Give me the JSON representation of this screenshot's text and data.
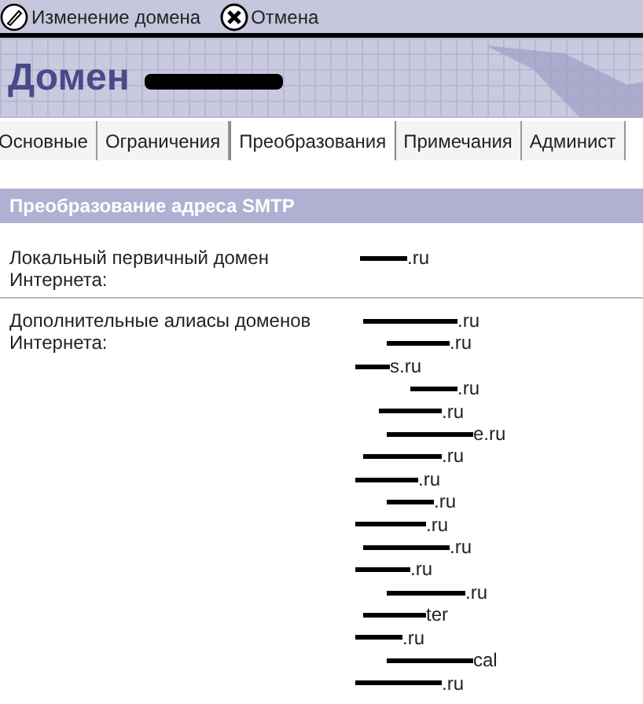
{
  "toolbar": [
    {
      "kind": "edit",
      "label": "Изменение домена"
    },
    {
      "kind": "cancel",
      "label": "Отмена"
    }
  ],
  "banner": {
    "title": "Домен",
    "name_redacted": true
  },
  "tabs": [
    {
      "label": "Основные",
      "selected": false
    },
    {
      "label": "Ограничения",
      "selected": false
    },
    {
      "label": "Преобразования",
      "selected": true
    },
    {
      "label": "Примечания",
      "selected": false
    },
    {
      "label": "Админист",
      "selected": false
    }
  ],
  "section": {
    "title": "Преобразование адреса SMTP"
  },
  "fields": [
    {
      "label": "Локальный первичный домен Интернета:",
      "values": [
        ".ru"
      ]
    },
    {
      "label": "Дополнительные алиасы доменов Интернета:",
      "values": [
        ".ru",
        ".ru",
        "s.ru",
        ".ru",
        ".ru",
        "e.ru",
        ".ru",
        ".ru",
        ".ru",
        ".ru",
        ".ru",
        ".ru",
        ".ru",
        "ter",
        ".ru",
        "cal",
        ".ru"
      ]
    }
  ]
}
